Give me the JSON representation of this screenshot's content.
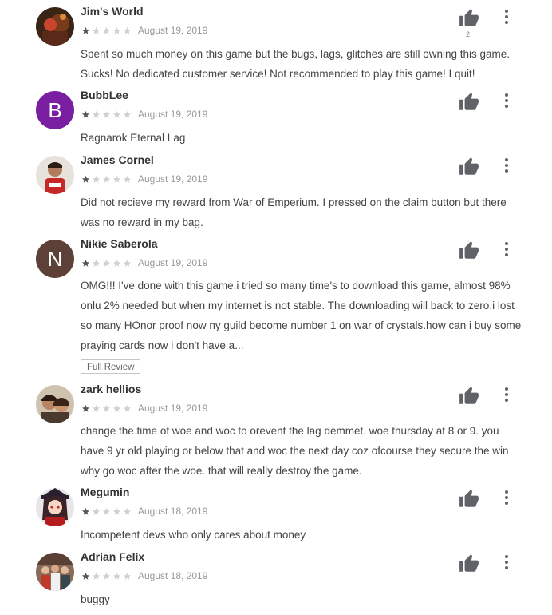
{
  "reviews": [
    {
      "author": "Jim's World",
      "rating": 1,
      "date": "August 19, 2019",
      "helpful_count": "2",
      "text": "Spent so much money on this game but the bugs, lags, glitches are still owning this game. Sucks! No dedicated customer service! Not recommended to play this game! I quit!"
    },
    {
      "author": "BubbLee",
      "avatar_letter": "B",
      "avatar_color": "#7b1fa2",
      "rating": 1,
      "date": "August 19, 2019",
      "text": "Ragnarok Eternal Lag"
    },
    {
      "author": "James Cornel",
      "rating": 1,
      "date": "August 19, 2019",
      "text": "Did not recieve my reward from War of Emperium. I pressed on the claim button but there was no reward in my bag."
    },
    {
      "author": "Nikie Saberola",
      "avatar_letter": "N",
      "avatar_color": "#5d4037",
      "rating": 1,
      "date": "August 19, 2019",
      "text": "OMG!!! I've done with this game.i tried so many time's to download this game, almost 98% onlu 2% needed but when my internet is not stable. The downloading will back to zero.i lost so many HOnor proof now ny guild become number 1 on war of crystals.how can i buy some praying cards now i don't have a...",
      "full_review_label": "Full Review"
    },
    {
      "author": "zark hellios",
      "rating": 1,
      "date": "August 19, 2019",
      "text": "change the time of woe and woc to orevent the lag demmet. woe thursday at 8 or 9. you have 9 yr old playing or below that and woc the next day coz ofcourse they secure the win why go woc after the woe. that will really destroy the game."
    },
    {
      "author": "Megumin",
      "rating": 1,
      "date": "August 18, 2019",
      "text": "Incompetent devs who only cares about money"
    },
    {
      "author": "Adrian Felix",
      "rating": 1,
      "date": "August 18, 2019",
      "text": "buggy"
    }
  ],
  "colors": {
    "star_filled": "#555555",
    "star_empty": "#d0d0d0",
    "icon": "#5f6368"
  },
  "icons": {
    "thumb": "thumbs-up-icon",
    "menu": "more-vert-icon"
  }
}
